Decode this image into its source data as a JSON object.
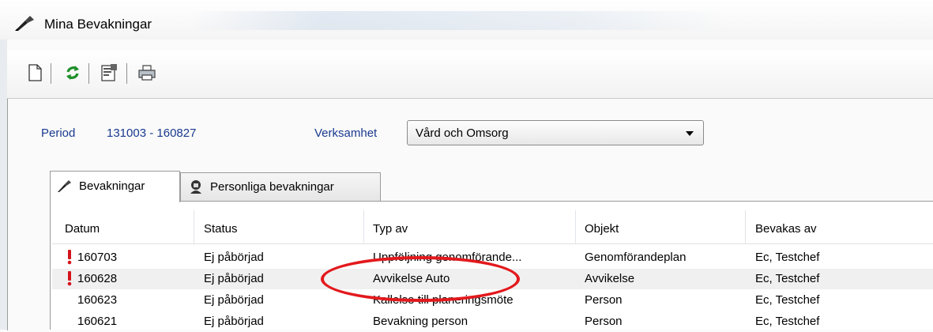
{
  "window": {
    "title": "Mina Bevakningar",
    "icon": "pen-icon"
  },
  "toolbar": {
    "buttons": [
      {
        "name": "new-document-icon"
      },
      {
        "name": "refresh-icon"
      },
      {
        "name": "properties-icon"
      },
      {
        "name": "print-icon"
      }
    ]
  },
  "filters": {
    "period_label": "Period",
    "period_value": "131003 - 160827",
    "verksamhet_label": "Verksamhet",
    "verksamhet_selected": "Vård och Omsorg"
  },
  "tabs": [
    {
      "label": "Bevakningar",
      "icon": "pen-icon",
      "active": true
    },
    {
      "label": "Personliga bevakningar",
      "icon": "person-icon",
      "active": false
    }
  ],
  "table": {
    "columns": [
      "Datum",
      "Status",
      "Typ av",
      "Objekt",
      "Bevakas av"
    ],
    "rows": [
      {
        "flag": true,
        "datum": "160703",
        "status": "Ej påbörjad",
        "typ": "Uppföljning genomförande...",
        "objekt": "Genomförandeplan",
        "bevakas": "Ec, Testchef"
      },
      {
        "flag": true,
        "datum": "160628",
        "status": "Ej påbörjad",
        "typ": "Avvikelse Auto",
        "objekt": "Avvikelse",
        "bevakas": "Ec, Testchef"
      },
      {
        "flag": false,
        "datum": "160623",
        "status": "Ej påbörjad",
        "typ": "Kallelse till planeringsmöte",
        "objekt": "Person",
        "bevakas": "Ec, Testchef"
      },
      {
        "flag": false,
        "datum": "160621",
        "status": "Ej påbörjad",
        "typ": "Bevakning person",
        "objekt": "Person",
        "bevakas": "Ec, Testchef"
      }
    ]
  },
  "colors": {
    "label_blue": "#1a3a8f",
    "flag_red": "#d4141c",
    "highlight_ellipse": "#e3191d"
  }
}
